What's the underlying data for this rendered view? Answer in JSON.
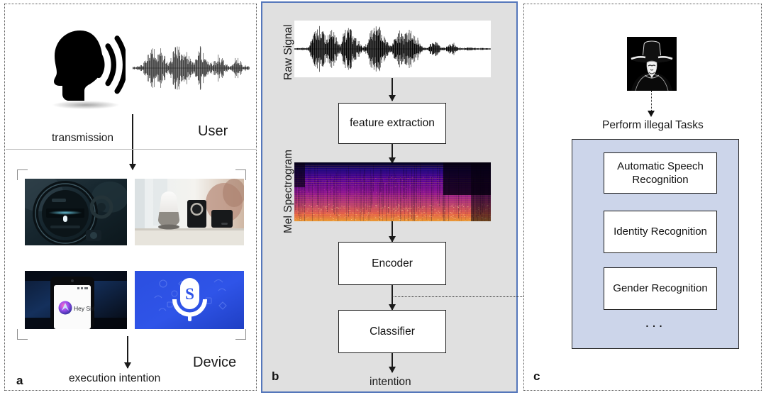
{
  "figure": {
    "type": "diagram",
    "caption_letters": {
      "a": "a",
      "b": "b",
      "c": "c"
    }
  },
  "panel_a": {
    "letter": "a",
    "user_label": "User",
    "device_label": "Device",
    "transmission_label": "transmission",
    "execution_label": "execution intention",
    "icons": {
      "speaking_head": "speaking-head-icon",
      "waveform": "audio-waveform-icon"
    },
    "devices": [
      {
        "name": "car-infotainment",
        "caption": ""
      },
      {
        "name": "smart-speakers",
        "caption": ""
      },
      {
        "name": "siri-phone",
        "caption": "Hey Siri"
      },
      {
        "name": "voice-assistant-app",
        "caption": "S"
      }
    ]
  },
  "panel_b": {
    "letter": "b",
    "axis_labels": {
      "raw_signal": "Raw Signal",
      "mel_spectrogram": "Mel Spectrogram"
    },
    "stages": [
      {
        "id": "raw-signal",
        "label": "",
        "kind": "image"
      },
      {
        "id": "feature-extraction",
        "label": "feature extraction",
        "kind": "box"
      },
      {
        "id": "mel-spectrogram",
        "label": "",
        "kind": "image"
      },
      {
        "id": "encoder",
        "label": "Encoder",
        "kind": "box"
      },
      {
        "id": "classifier",
        "label": "Classifier",
        "kind": "box"
      }
    ],
    "output_label": "intention",
    "background_color": "#e0e0e0",
    "border_color": "#5577bb"
  },
  "panel_c": {
    "letter": "c",
    "attacker_icon": "anonymous-hacker-icon",
    "attack_label": "Perform illegal Tasks",
    "tasks": [
      "Automatic Speech Recognition",
      "Identity Recognition",
      "Gender Recognition"
    ],
    "ellipsis": "...",
    "task_panel_color": "#ccd5ea"
  }
}
